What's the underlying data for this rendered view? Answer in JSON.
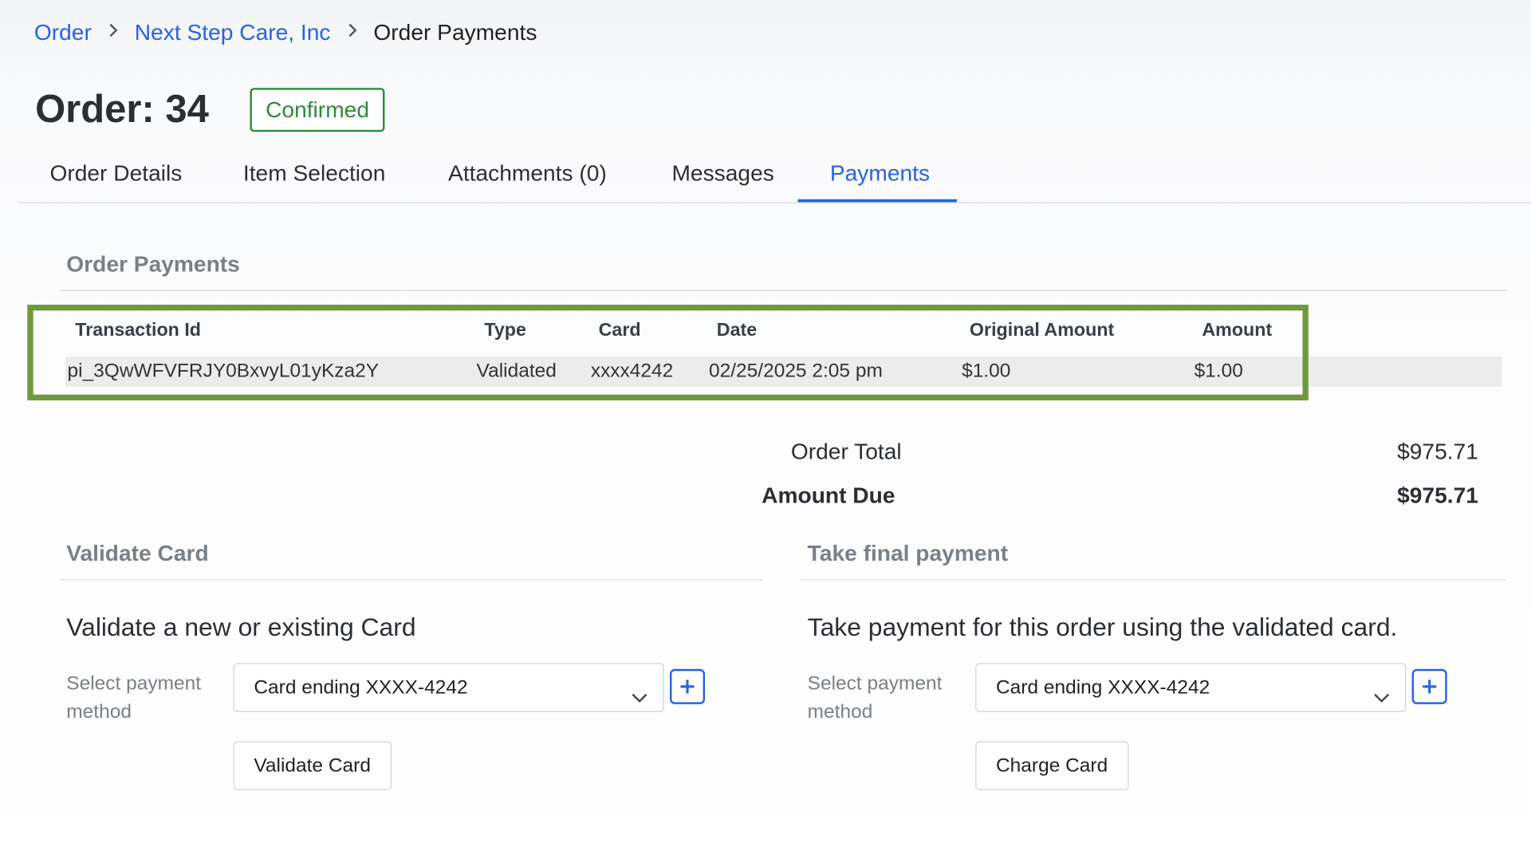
{
  "breadcrumb": {
    "items": [
      {
        "label": "Order"
      },
      {
        "label": "Next Step Care, Inc"
      },
      {
        "label": "Order Payments"
      }
    ]
  },
  "header": {
    "title": "Order: 34",
    "status": "Confirmed"
  },
  "tabs": [
    {
      "label": "Order Details"
    },
    {
      "label": "Item Selection"
    },
    {
      "label": "Attachments (0)"
    },
    {
      "label": "Messages"
    },
    {
      "label": "Payments",
      "active": true
    }
  ],
  "payments": {
    "heading": "Order Payments",
    "columns": [
      "Transaction Id",
      "Type",
      "Card",
      "Date",
      "Original Amount",
      "Amount"
    ],
    "rows": [
      [
        "pi_3QwWFVFRJY0BxvyL01yKza2Y",
        "Validated",
        "xxxx4242",
        "02/25/2025 2:05 pm",
        "$1.00",
        "$1.00"
      ]
    ]
  },
  "totals": {
    "order_total_label": "Order Total",
    "order_total_value": "$975.71",
    "amount_due_label": "Amount Due",
    "amount_due_value": "$975.71"
  },
  "validate_card": {
    "heading": "Validate Card",
    "subtitle": "Validate a new or existing Card",
    "field_label": "Select payment method",
    "selected": "Card ending XXXX-4242",
    "button": "Validate Card"
  },
  "final_payment": {
    "heading": "Take final payment",
    "subtitle": "Take payment for this order using the validated card.",
    "field_label": "Select payment method",
    "selected": "Card ending XXXX-4242",
    "button": "Charge Card"
  },
  "colors": {
    "link": "#2563eb",
    "status_green": "#2f8a3a",
    "highlight_green": "#6e9a3b"
  }
}
